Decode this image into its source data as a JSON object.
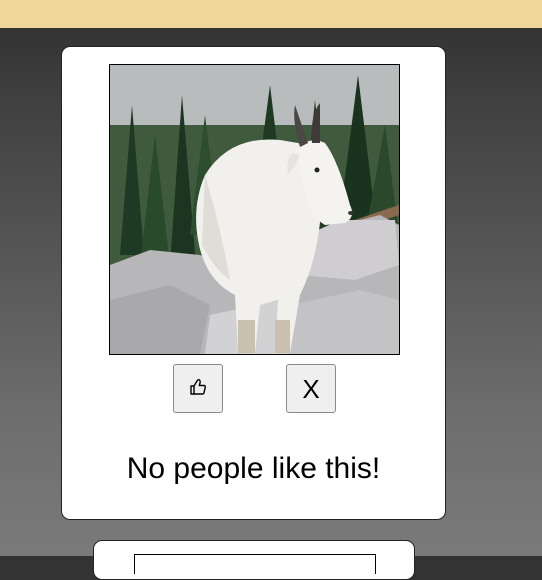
{
  "header": {
    "color": "#f0d698"
  },
  "post": {
    "image": {
      "subject": "mountain goat on rocks"
    },
    "like_button": {
      "icon": "thumbs-up-icon"
    },
    "dismiss_button": {
      "label": "X"
    },
    "likes_text": "No people like this!"
  }
}
